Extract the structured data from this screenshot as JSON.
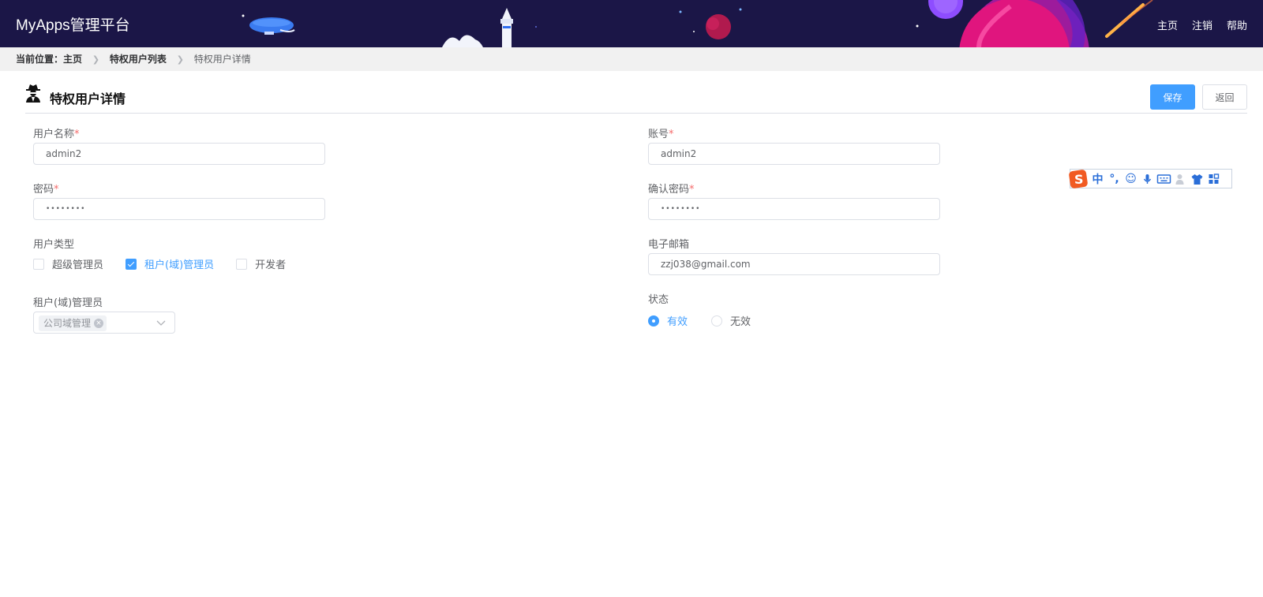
{
  "header": {
    "app_title": "MyApps管理平台",
    "nav": [
      "主页",
      "注销",
      "帮助"
    ]
  },
  "breadcrumb": {
    "prefix": "当前位置：主页",
    "items": [
      "特权用户列表",
      "特权用户详情"
    ]
  },
  "page": {
    "title": "特权用户详情",
    "save_label": "保存",
    "back_label": "返回"
  },
  "form": {
    "username": {
      "label": "用户名称",
      "required": "*",
      "value": "admin2"
    },
    "account": {
      "label": "账号",
      "required": "*",
      "value": "admin2"
    },
    "password": {
      "label": "密码",
      "required": "*",
      "value": "••••••••"
    },
    "confirm_password": {
      "label": "确认密码",
      "required": "*",
      "value": "••••••••"
    },
    "user_type": {
      "label": "用户类型",
      "options": [
        {
          "label": "超级管理员",
          "checked": false
        },
        {
          "label": "租户(域)管理员",
          "checked": true
        },
        {
          "label": "开发者",
          "checked": false
        }
      ]
    },
    "email": {
      "label": "电子邮箱",
      "value": "zzj038@gmail.com"
    },
    "tenant_admin": {
      "label": "租户(域)管理员",
      "selected_tag": "公司域管理"
    },
    "status": {
      "label": "状态",
      "options": [
        {
          "label": "有效",
          "checked": true
        },
        {
          "label": "无效",
          "checked": false
        }
      ]
    }
  },
  "ime_toolbar": {
    "items": [
      "中",
      "°,",
      "☺",
      "mic-icon",
      "keyboard-icon",
      "user-icon",
      "shirt-icon",
      "grid-icon"
    ]
  },
  "colors": {
    "header_bg": "#1b1647",
    "primary": "#409eff",
    "required": "#f56c6c"
  }
}
